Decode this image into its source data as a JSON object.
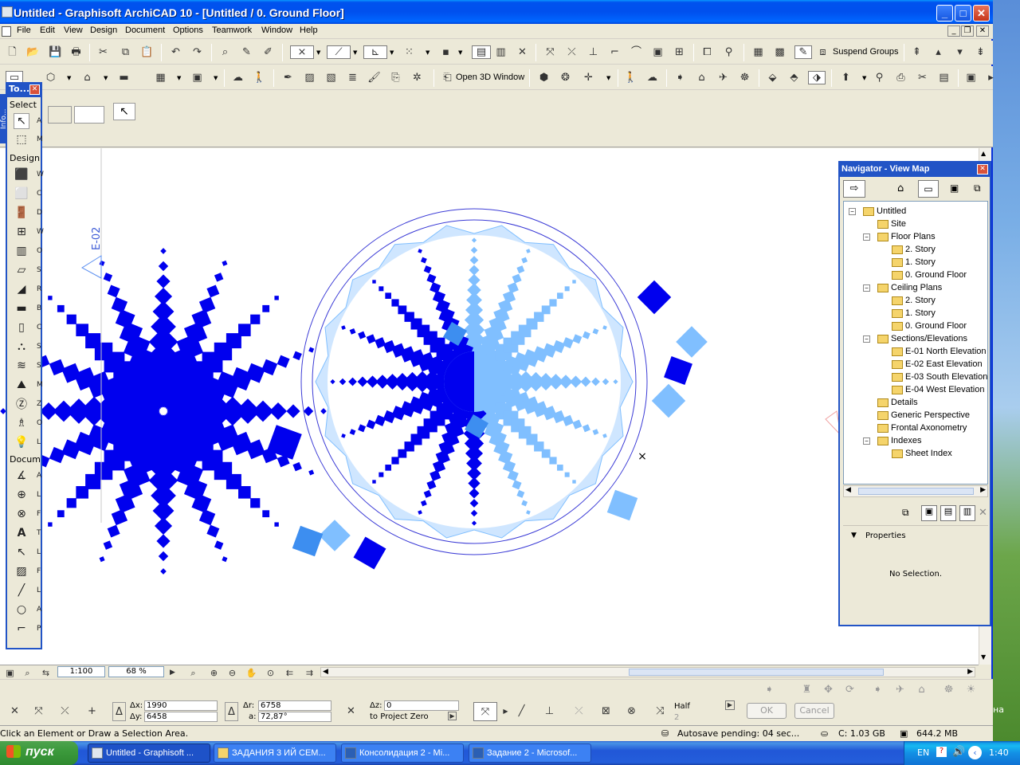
{
  "window": {
    "title": "Untitled - Graphisoft ArchiCAD 10 - [Untitled / 0. Ground Floor]",
    "btn_min": "_",
    "btn_max": "□",
    "btn_close": "✕"
  },
  "menu": {
    "items": [
      "File",
      "Edit",
      "View",
      "Design",
      "Document",
      "Options",
      "Teamwork",
      "Window",
      "Help"
    ],
    "mdi_min": "_",
    "mdi_restore": "❐",
    "mdi_close": "✕"
  },
  "toolbar": {
    "suspend_groups": "Suspend Groups",
    "open_3d": "Open 3D Window"
  },
  "toolbox": {
    "title": "To...",
    "close": "✕",
    "select_label": "Select",
    "design_label": "Design",
    "document_label": "Docum",
    "select_items": [
      "A",
      "M"
    ],
    "design_items": [
      "W",
      "C",
      "D",
      "W",
      "O",
      "S",
      "R",
      "B",
      "C",
      "S",
      "S",
      "M",
      "Z",
      "O",
      "L"
    ],
    "document_items": [
      "A",
      "L",
      "F",
      "T",
      "L",
      "F",
      "L",
      "A",
      "P"
    ],
    "info_tab": "Info..."
  },
  "canvas": {
    "elevation_marker": "E-02",
    "cursor": "×"
  },
  "navigator": {
    "title": "Navigator - View Map",
    "close": "✕",
    "tree": [
      {
        "label": "Untitled",
        "level": 0,
        "expanded": true
      },
      {
        "label": "Site",
        "level": 1
      },
      {
        "label": "Floor Plans",
        "level": 1,
        "expanded": true
      },
      {
        "label": "2. Story",
        "level": 2
      },
      {
        "label": "1. Story",
        "level": 2
      },
      {
        "label": "0. Ground Floor",
        "level": 2
      },
      {
        "label": "Ceiling Plans",
        "level": 1,
        "expanded": true
      },
      {
        "label": "2. Story",
        "level": 2
      },
      {
        "label": "1. Story",
        "level": 2
      },
      {
        "label": "0. Ground Floor",
        "level": 2
      },
      {
        "label": "Sections/Elevations",
        "level": 1,
        "expanded": true
      },
      {
        "label": "E-01 North Elevation",
        "level": 2
      },
      {
        "label": "E-02 East Elevation",
        "level": 2
      },
      {
        "label": "E-03 South Elevation",
        "level": 2
      },
      {
        "label": "E-04 West Elevation",
        "level": 2
      },
      {
        "label": "Details",
        "level": 1
      },
      {
        "label": "Generic Perspective",
        "level": 1
      },
      {
        "label": "Frontal Axonometry",
        "level": 1
      },
      {
        "label": "Indexes",
        "level": 1,
        "expanded": true
      },
      {
        "label": "Sheet Index",
        "level": 2
      }
    ],
    "properties_label": "Properties",
    "no_selection": "No Selection."
  },
  "viewbar": {
    "scale": "1:100",
    "zoom": "68 %"
  },
  "coords": {
    "dx_label": "Δx:",
    "dx": "1990",
    "dy_label": "Δy:",
    "dy": "6458",
    "dr_label": "Δr:",
    "dr": "6758",
    "a_label": "a:",
    "a": "72,87°",
    "dz_label": "Δz:",
    "dz": "0",
    "to_project_zero": "to Project Zero",
    "half": "Half",
    "half_num": "2",
    "ok": "OK",
    "cancel": "Cancel"
  },
  "status": {
    "hint": "Click an Element or Draw a Selection Area.",
    "autosave": "Autosave pending: 04 sec...",
    "disk": "C: 1.03 GB",
    "memory": "644.2 MB"
  },
  "taskbar": {
    "start": "пуск",
    "tasks": [
      "Untitled - Graphisoft ...",
      "ЗАДАНИЯ 3 ИЙ СЕМ...",
      "Консолидация 2 - Mi...",
      "Задание 2 - Microsof..."
    ],
    "lang": "EN",
    "clock": "1:40"
  },
  "desktop": {
    "side_text": "на"
  },
  "colors": {
    "dark_blue": "#0000ee",
    "light_blue": "#80bfff",
    "mid_blue": "#3d8ef0",
    "circle": "#3b3bd6",
    "titlebar": "#0054e3"
  }
}
